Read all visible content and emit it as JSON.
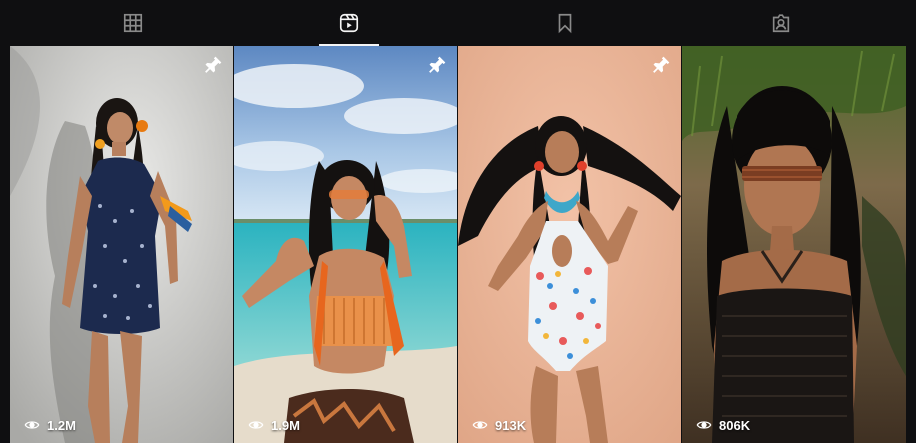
{
  "tabs": [
    {
      "name": "posts",
      "icon": "grid-icon",
      "active": false
    },
    {
      "name": "reels",
      "icon": "reels-icon",
      "active": true
    },
    {
      "name": "saved",
      "icon": "bookmark-icon",
      "active": false
    },
    {
      "name": "tagged",
      "icon": "tagged-user-icon",
      "active": false
    }
  ],
  "reels": [
    {
      "views": "1.2M",
      "pinned": true
    },
    {
      "views": "1.9M",
      "pinned": true
    },
    {
      "views": "913K",
      "pinned": true
    },
    {
      "views": "806K",
      "pinned": false
    }
  ],
  "colors": {
    "background": "#0f0f11",
    "active_indicator": "#f5f5f5",
    "icon_inactive": "#8a8a8a",
    "icon_active": "#f5f5f5"
  }
}
